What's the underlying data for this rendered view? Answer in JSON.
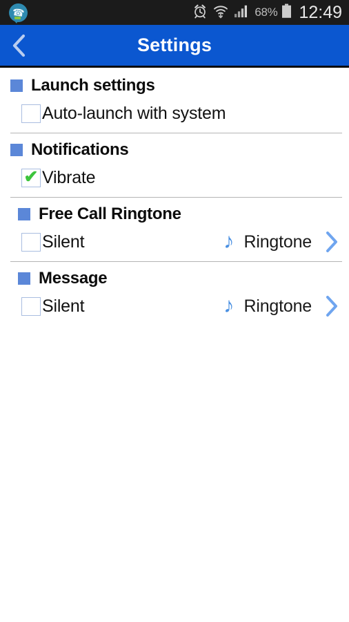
{
  "statusbar": {
    "app_icon": "phone-chat-bubble-icon",
    "alarm_icon": "alarm-clock-icon",
    "wifi_icon": "wifi-transfer-icon",
    "signal_icon": "cellular-signal-icon",
    "battery_percent": "68%",
    "battery_icon": "battery-icon",
    "clock": "12:49",
    "bg_color": "#1b1b1b"
  },
  "appbar": {
    "back_icon": "chevron-left-icon",
    "title": "Settings",
    "bg_color": "#0b57d0",
    "title_color": "#ffffff"
  },
  "colors": {
    "bullet_blue": "#5b87d8",
    "accent_blue": "#4a90e2",
    "check_green": "#3dc43d",
    "checkbox_border": "#a9bde0",
    "divider": "#b4b4b4"
  },
  "sections": [
    {
      "title": "Launch settings",
      "bullet": "blue-square-bullet",
      "indented": false,
      "rows": [
        {
          "type": "checkbox",
          "label": "Auto-launch with system",
          "checked": false
        }
      ],
      "divider_after": true
    },
    {
      "title": "Notifications",
      "bullet": "blue-square-bullet",
      "indented": false,
      "rows": [
        {
          "type": "checkbox",
          "label": "Vibrate",
          "checked": true,
          "check_glyph": "✔"
        }
      ],
      "divider_after": true
    },
    {
      "title": "Free Call Ringtone",
      "bullet": "blue-square-bullet",
      "indented": true,
      "rows": [
        {
          "type": "checkbox-with-ringtone",
          "label": "Silent",
          "checked": false,
          "note_glyph": "♪",
          "note_icon": "music-note-icon",
          "ringtone_label": "Ringtone",
          "chevron_icon": "chevron-right-icon"
        }
      ],
      "divider_after": true
    },
    {
      "title": "Message",
      "bullet": "blue-square-bullet",
      "indented": true,
      "rows": [
        {
          "type": "checkbox-with-ringtone",
          "label": "Silent",
          "checked": false,
          "note_glyph": "♪",
          "note_icon": "music-note-icon",
          "ringtone_label": "Ringtone",
          "chevron_icon": "chevron-right-icon"
        }
      ],
      "divider_after": false
    }
  ]
}
